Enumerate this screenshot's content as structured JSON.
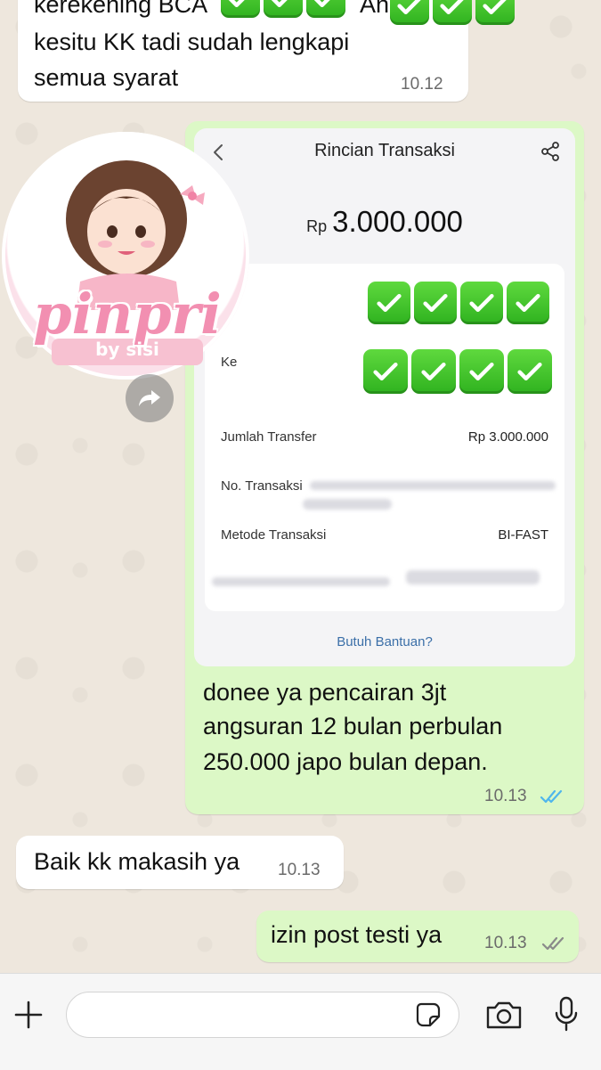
{
  "messages": {
    "top_in": {
      "line1_prefix": "kerekening BCA",
      "line1_suffix": "An",
      "line2": "kesitu KK tadi sudah lengkapi",
      "line3": "semua syarat",
      "time": "10.12"
    },
    "transfer_out": {
      "line1": "donee ya pencairan 3jt",
      "line2": "angsuran 12 bulan perbulan",
      "line3": "250.000 japo bulan depan.",
      "time": "10.13",
      "status": "read"
    },
    "reply_in": {
      "text": "Baik kk makasih ya",
      "time": "10.13"
    },
    "last_out": {
      "text": "izin post testi ya",
      "time": "10.13",
      "status": "delivered"
    }
  },
  "sticker": {
    "brand": "pinpri",
    "byline": "by sisi"
  },
  "receipt": {
    "title": "Rincian Transaksi",
    "amount_currency": "Rp",
    "amount_value": "3.000.000",
    "to_label": "Ke",
    "rows": [
      {
        "label": "Jumlah Transfer",
        "value": "Rp 3.000.000"
      },
      {
        "label": "No. Transaksi",
        "value": ""
      },
      {
        "label": "Metode Transaksi",
        "value": "BI-FAST"
      }
    ],
    "help_link": "Butuh Bantuan?"
  },
  "composer": {
    "placeholder": ""
  },
  "icons": {
    "check": "check-emoji-icon",
    "read_ticks_color": "#4fb6ec",
    "delivered_ticks_color": "#8a8a8a"
  }
}
